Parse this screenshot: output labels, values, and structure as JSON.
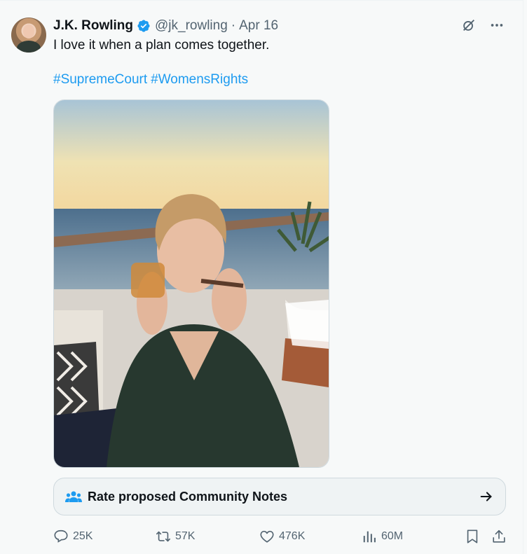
{
  "post": {
    "author_name": "J.K. Rowling",
    "handle": "@jk_rowling",
    "separator": "·",
    "date": "Apr 16",
    "text": "I love it when a plan comes together.",
    "hashtags": [
      "#SupremeCourt",
      "#WomensRights"
    ]
  },
  "community_notes": {
    "label": "Rate proposed Community Notes"
  },
  "actions": {
    "replies": "25K",
    "reposts": "57K",
    "likes": "476K",
    "views": "60M"
  },
  "colors": {
    "accent": "#1d9bf0",
    "secondary_text": "#536471",
    "primary_text": "#0f1419",
    "background": "#f7f9f9"
  },
  "icons": [
    "verified-badge-icon",
    "grok-icon",
    "more-icon",
    "community-icon",
    "arrow-right-icon",
    "reply-icon",
    "repost-icon",
    "like-icon",
    "views-icon",
    "bookmark-icon",
    "share-icon"
  ]
}
